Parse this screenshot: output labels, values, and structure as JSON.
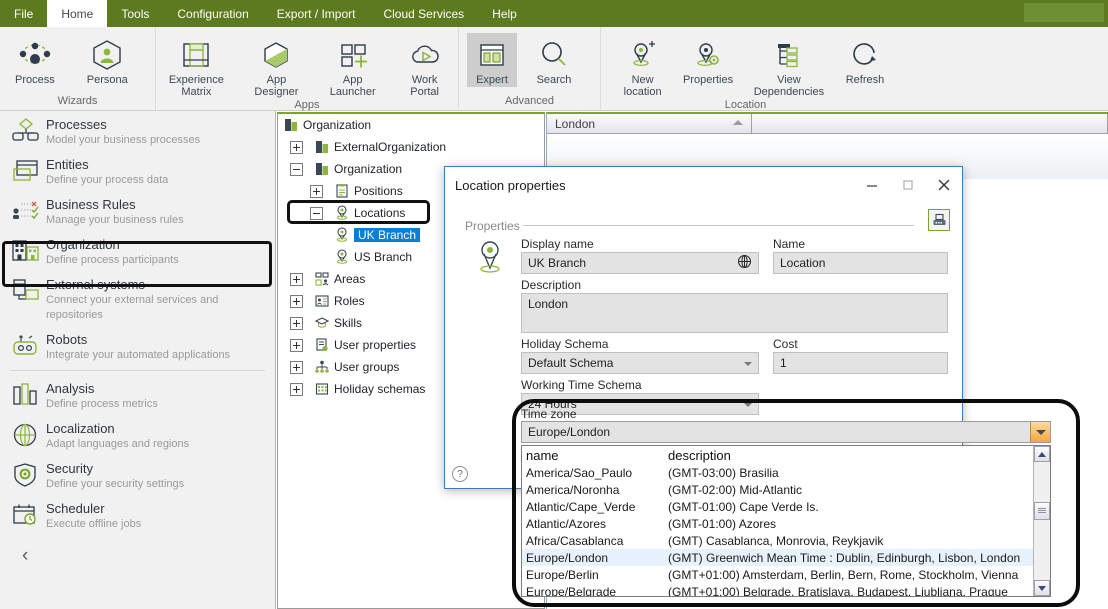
{
  "menubar": {
    "items": [
      {
        "label": "File",
        "active": false
      },
      {
        "label": "Home",
        "active": true
      },
      {
        "label": "Tools",
        "active": false
      },
      {
        "label": "Configuration",
        "active": false
      },
      {
        "label": "Export / Import",
        "active": false
      },
      {
        "label": "Cloud Services",
        "active": false
      },
      {
        "label": "Help",
        "active": false
      }
    ]
  },
  "ribbon": {
    "groups": [
      {
        "label": "Wizards",
        "buttons": [
          {
            "label": "Process",
            "icon": "process-network-icon",
            "selected": false
          },
          {
            "label": "Persona",
            "icon": "persona-hexagon-icon",
            "selected": false
          }
        ]
      },
      {
        "label": "Apps",
        "buttons": [
          {
            "label": "Experience\nMatrix",
            "icon": "experience-matrix-icon",
            "selected": false
          },
          {
            "label": "App Designer",
            "icon": "app-designer-hexagon-icon",
            "selected": false
          },
          {
            "label": "App Launcher",
            "icon": "app-launcher-grid-icon",
            "selected": false
          },
          {
            "label": "Work Portal",
            "icon": "work-portal-cloud-icon",
            "selected": false
          }
        ]
      },
      {
        "label": "Advanced",
        "buttons": [
          {
            "label": "Expert",
            "icon": "expert-panel-icon",
            "selected": true
          },
          {
            "label": "Search",
            "icon": "search-magnifier-icon",
            "selected": false
          }
        ]
      },
      {
        "label": "Location",
        "buttons": [
          {
            "label": "New location",
            "icon": "new-location-pin-icon",
            "selected": false
          },
          {
            "label": "Properties",
            "icon": "location-properties-pin-icon",
            "selected": false
          },
          {
            "label": "View Dependencies",
            "icon": "view-dependencies-tree-icon",
            "selected": false
          },
          {
            "label": "Refresh",
            "icon": "refresh-circular-arrow-icon",
            "selected": false
          }
        ]
      }
    ]
  },
  "sidebar": {
    "items": [
      {
        "title": "Processes",
        "subtitle": "Model your business processes",
        "icon": "processes-icon",
        "highlighted": false
      },
      {
        "title": "Entities",
        "subtitle": "Define your process data",
        "icon": "entities-icon",
        "highlighted": false
      },
      {
        "title": "Business  Rules",
        "subtitle": "Manage your business rules",
        "icon": "business-rules-icon",
        "highlighted": false
      },
      {
        "title": "Organization",
        "subtitle": "Define process participants",
        "icon": "organization-icon",
        "highlighted": true
      },
      {
        "title": "External systems",
        "subtitle": "Connect your external services and repositories",
        "icon": "external-systems-icon",
        "highlighted": false
      },
      {
        "title": "Robots",
        "subtitle": "Integrate your automated applications",
        "icon": "robots-icon",
        "highlighted": false
      },
      {
        "title": "Analysis",
        "subtitle": "Define process metrics",
        "icon": "analysis-icon",
        "highlighted": false
      },
      {
        "title": "Localization",
        "subtitle": "Adapt languages and regions",
        "icon": "localization-globe-icon",
        "highlighted": false
      },
      {
        "title": "Security",
        "subtitle": "Define your security settings",
        "icon": "security-shield-icon",
        "highlighted": false
      },
      {
        "title": "Scheduler",
        "subtitle": "Execute offline jobs",
        "icon": "scheduler-calendar-icon",
        "highlighted": false
      }
    ],
    "collapse_glyph": "‹"
  },
  "tree": {
    "nodes": [
      {
        "label": "Organization",
        "indent": 0,
        "expander": "none",
        "icon": "org-building-icon",
        "selected": false
      },
      {
        "label": "ExternalOrganization",
        "indent": 1,
        "expander": "plus",
        "icon": "org-building-icon",
        "selected": false
      },
      {
        "label": "Organization",
        "indent": 1,
        "expander": "minus",
        "icon": "org-building-icon",
        "selected": false
      },
      {
        "label": "Positions",
        "indent": 2,
        "expander": "plus",
        "icon": "positions-clipboard-icon",
        "selected": false
      },
      {
        "label": "Locations",
        "indent": 2,
        "expander": "minus",
        "icon": "location-pin-icon",
        "selected": false
      },
      {
        "label": "UK Branch",
        "indent": 3,
        "expander": "none",
        "icon": "location-pin-icon",
        "selected": true
      },
      {
        "label": "US Branch",
        "indent": 3,
        "expander": "none",
        "icon": "location-pin-icon",
        "selected": false
      },
      {
        "label": "Areas",
        "indent": 1,
        "expander": "plus",
        "icon": "areas-icon",
        "selected": false
      },
      {
        "label": "Roles",
        "indent": 1,
        "expander": "plus",
        "icon": "roles-icon",
        "selected": false
      },
      {
        "label": "Skills",
        "indent": 1,
        "expander": "plus",
        "icon": "skills-cap-icon",
        "selected": false
      },
      {
        "label": "User properties",
        "indent": 1,
        "expander": "plus",
        "icon": "user-properties-icon",
        "selected": false
      },
      {
        "label": "User groups",
        "indent": 1,
        "expander": "plus",
        "icon": "user-groups-icon",
        "selected": false
      },
      {
        "label": "Holiday schemas",
        "indent": 1,
        "expander": "plus",
        "icon": "holiday-schemas-icon",
        "selected": false
      }
    ]
  },
  "grid": {
    "columns": [
      {
        "label": "London",
        "sort": "ascending"
      },
      {
        "label": ""
      }
    ]
  },
  "dialog": {
    "title": "Location properties",
    "minimize_glyph": "—",
    "maximize_glyph": "□",
    "close_glyph": "✕",
    "section_label": "Properties",
    "toolbutton_icon": "server-save-icon",
    "pin_icon": "location-pin-icon",
    "help_glyph": "?",
    "fields": {
      "display_name_label": "Display name",
      "display_name_value": "UK Branch",
      "display_name_icon": "globe-translate-icon",
      "name_label": "Name",
      "name_value": "Location",
      "description_label": "Description",
      "description_value": "London",
      "holiday_schema_label": "Holiday Schema",
      "holiday_schema_value": "Default Schema",
      "cost_label": "Cost",
      "cost_value": "1",
      "working_time_label": "Working Time Schema",
      "working_time_value": "24 Hours"
    }
  },
  "timezone": {
    "label": "Time zone",
    "selected": "Europe/London",
    "columns": {
      "name": "name",
      "description": "description"
    },
    "options": [
      {
        "name": "America/Sao_Paulo",
        "description": "(GMT-03:00) Brasilia",
        "selected": false
      },
      {
        "name": "America/Noronha",
        "description": "(GMT-02:00) Mid-Atlantic",
        "selected": false
      },
      {
        "name": "Atlantic/Cape_Verde",
        "description": "(GMT-01:00) Cape Verde Is.",
        "selected": false
      },
      {
        "name": "Atlantic/Azores",
        "description": "(GMT-01:00) Azores",
        "selected": false
      },
      {
        "name": "Africa/Casablanca",
        "description": "(GMT) Casablanca, Monrovia, Reykjavik",
        "selected": false
      },
      {
        "name": "Europe/London",
        "description": "(GMT) Greenwich Mean Time : Dublin, Edinburgh, Lisbon, London",
        "selected": true
      },
      {
        "name": "Europe/Berlin",
        "description": "(GMT+01:00) Amsterdam, Berlin, Bern, Rome, Stockholm, Vienna",
        "selected": false
      },
      {
        "name": "Europe/Belgrade",
        "description": "(GMT+01:00) Belgrade, Bratislava, Budapest, Ljubljana, Prague",
        "selected": false
      }
    ]
  },
  "colors": {
    "ribbon_green": "#5c7a1e",
    "accent_green": "#7ba428",
    "selection_blue": "#0b7fd4",
    "dialog_border": "#3d7bbd"
  }
}
